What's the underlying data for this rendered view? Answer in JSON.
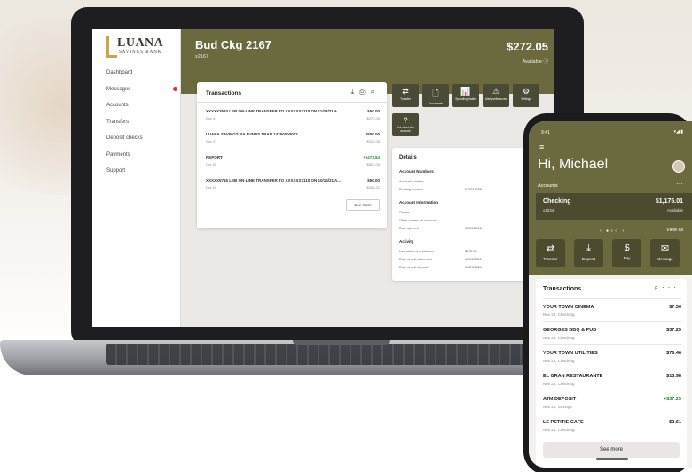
{
  "laptop": {
    "logo": {
      "name": "LUANA",
      "sub": "SAVINGS BANK"
    },
    "nav": [
      {
        "label": "Dashboard"
      },
      {
        "label": "Messages",
        "alert": true
      },
      {
        "label": "Accounts"
      },
      {
        "label": "Transfers"
      },
      {
        "label": "Deposit checks"
      },
      {
        "label": "Payments"
      },
      {
        "label": "Support"
      }
    ],
    "account": {
      "title": "Bud Ckg 2167",
      "number": "x2167",
      "balance": "$272.05",
      "balance_label": "Available"
    },
    "transactions": {
      "heading": "Transactions",
      "rows": [
        {
          "desc": "XXXXX3593 LSB ON-LINE TRANSFER TO XXXXXX7110 ON 11/03/21 A...",
          "date": "Nov 4",
          "amount": "$50.00",
          "running": "$272.05",
          "credit": false
        },
        {
          "desc": "LUANA SAVINGS BA FUNDS TRAN 14250000002",
          "date": "Nov 2",
          "amount": "$500.00",
          "running": "$322.05",
          "credit": false
        },
        {
          "desc": "REPORT",
          "date": "Oct 29",
          "amount": "+$473.84",
          "running": "$822.05",
          "credit": true
        },
        {
          "desc": "XXXXX5716 LSB ON-LINE TRANSFER TO XXXXXX7110 ON 10/14/21 A...",
          "date": "Oct 14",
          "amount": "$50.00",
          "running": "$348.21",
          "credit": false
        }
      ],
      "see_more": "See more"
    },
    "quick_actions": [
      {
        "label": "Transfer",
        "icon": "transfer-icon",
        "glyph": "⇄"
      },
      {
        "label": "Documents",
        "icon": "document-icon",
        "glyph": "🗋"
      },
      {
        "label": "Spending Habits",
        "icon": "chart-icon",
        "glyph": "📊"
      },
      {
        "label": "Alert preferences",
        "icon": "alert-icon",
        "glyph": "⚠"
      },
      {
        "label": "Settings",
        "icon": "gear-icon",
        "glyph": "⚙"
      },
      {
        "label": "Ask about this account",
        "icon": "question-icon",
        "glyph": "?"
      }
    ],
    "details": {
      "title": "Details",
      "numbers": {
        "heading": "Account Numbers",
        "rows": [
          {
            "label": "Account number",
            "value": ""
          },
          {
            "label": "Routing number",
            "value": "073914256"
          }
        ]
      },
      "info": {
        "heading": "Account Information",
        "rows": [
          {
            "label": "Owner",
            "value": ""
          },
          {
            "label": "Other names on account",
            "value": ""
          },
          {
            "label": "Date opened",
            "value": "11/09/2016"
          }
        ]
      },
      "activity": {
        "heading": "Activity",
        "rows": [
          {
            "label": "Last statement balance",
            "value": "$272.05"
          },
          {
            "label": "Date of last statement",
            "value": "11/04/2021"
          },
          {
            "label": "Date of last deposit",
            "value": "10/29/2021"
          }
        ]
      }
    }
  },
  "phone": {
    "time": "9:41",
    "signal": "▾◢ ▮",
    "greeting": "Hi, Michael",
    "accounts_label": "Accounts",
    "account": {
      "name": "Checking",
      "number": "x1234",
      "balance": "$1,175.01",
      "balance_label": "Available"
    },
    "pager": "‹  ●○○  ›",
    "view_all": "View all",
    "quick_actions": [
      {
        "label": "Transfer",
        "icon": "transfer-icon",
        "glyph": "⇄"
      },
      {
        "label": "Deposit",
        "icon": "deposit-icon",
        "glyph": "⤓"
      },
      {
        "label": "Pay",
        "icon": "pay-icon",
        "glyph": "$"
      },
      {
        "label": "Message",
        "icon": "message-icon",
        "glyph": "✉"
      }
    ],
    "transactions": {
      "heading": "Transactions",
      "rows": [
        {
          "desc": "YOUR TOWN CINEMA",
          "sub": "Nov 25, Checking",
          "amount": "$7.50",
          "credit": false
        },
        {
          "desc": "GEORGES BBQ & PUB",
          "sub": "Nov 25, Checking",
          "amount": "$37.25",
          "credit": false
        },
        {
          "desc": "YOUR TOWN UTILITIES",
          "sub": "Nov 25, Checking",
          "amount": "$76.46",
          "credit": false
        },
        {
          "desc": "EL GRAN RESTAURANTE",
          "sub": "Nov 25, Checking",
          "amount": "$13.98",
          "credit": false
        },
        {
          "desc": "ATM DEPOSIT",
          "sub": "Nov 25, Savings",
          "amount": "+$37.25",
          "credit": true
        },
        {
          "desc": "LE PETITIE CAFE",
          "sub": "Nov 24, Checking",
          "amount": "$2.61",
          "credit": false
        }
      ],
      "see_more": "See more"
    }
  },
  "colors": {
    "brand": "#6b6a3f",
    "brand_dark": "#4c4b30",
    "credit": "#2e8b3a",
    "alert": "#d9322f"
  }
}
